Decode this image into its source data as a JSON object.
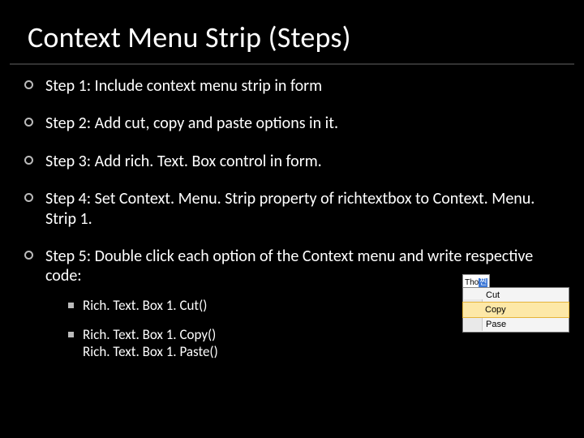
{
  "title": "Context Menu Strip (Steps)",
  "steps": [
    "Step 1: Include context menu strip in form",
    "Step 2: Add cut, copy and paste options in it.",
    "Step 3: Add rich. Text. Box control in form.",
    "Step 4: Set Context. Menu. Strip property of richtextbox to Context. Menu. Strip 1.",
    "Step 5: Double click each option of the Context menu and write respective code:"
  ],
  "code_lines": [
    "Rich. Text. Box 1. Cut()",
    "Rich. Text. Box 1. Copy()",
    "Rich. Text. Box 1. Paste()"
  ],
  "menu_graphic": {
    "tag_plain": "Tho",
    "tag_selected": "찐",
    "items": [
      "Cut",
      "Copy",
      "Pase"
    ],
    "hover_index": 1
  }
}
